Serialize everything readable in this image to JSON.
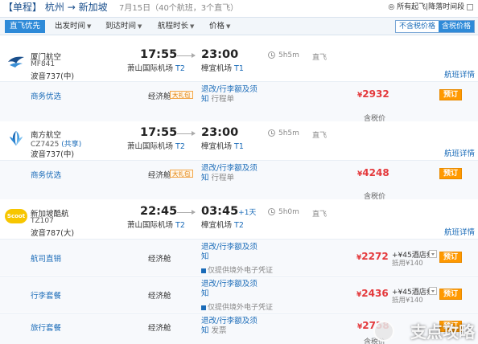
{
  "header": {
    "tag": "【单程】",
    "route_from": "杭州",
    "route_to": "新加坡",
    "summary": "7月15日（40个航班，3个直飞）",
    "opt_label": "所有起飞|降落时间段",
    "opt_prefix": "◎"
  },
  "toolbar": {
    "direct_first": "直飞优先",
    "sort_depart": "出发时间",
    "sort_arrive": "到达时间",
    "sort_duration": "航程时长",
    "sort_price": "价格",
    "price_excl_tax": "不含税价格",
    "price_incl_tax": "含税价格"
  },
  "flights": [
    {
      "airline": "厦门航空",
      "flight_no": "MF841",
      "aircraft": "波音737(中)",
      "dep_time": "17:55",
      "dep_airport": "萧山国际机场",
      "dep_terminal": "T2",
      "arr_time": "23:00",
      "arr_plus": "",
      "arr_airport": "樟宜机场",
      "arr_terminal": "T1",
      "duration": "5h5m",
      "stops": "直飞",
      "detail": "航班详情",
      "logo_color": "#1a4f8c",
      "fares": [
        {
          "label": "商务优选",
          "cabin": "经济舱",
          "badge": "大礼包",
          "rule_line1": "退改/行李额及须",
          "rule_line2": "知",
          "rule_line2_tail": "行程单",
          "price_symbol": "¥",
          "price": "2932",
          "tax": "含税价",
          "book": "预订"
        }
      ]
    },
    {
      "airline": "南方航空",
      "flight_no": "CZ7425",
      "codeshare": "(共享)",
      "aircraft": "波音737(中)",
      "dep_time": "17:55",
      "dep_airport": "萧山国际机场",
      "dep_terminal": "T2",
      "arr_time": "23:00",
      "arr_plus": "",
      "arr_airport": "樟宜机场",
      "arr_terminal": "T1",
      "duration": "5h5m",
      "stops": "直飞",
      "detail": "航班详情",
      "logo_color": "#1a6bb8",
      "fares": [
        {
          "label": "商务优选",
          "cabin": "经济舱",
          "badge": "大礼包",
          "rule_line1": "退改/行李额及须",
          "rule_line2": "知",
          "rule_line2_tail": "行程单",
          "price_symbol": "¥",
          "price": "4248",
          "tax": "含税价",
          "book": "预订"
        }
      ]
    },
    {
      "airline": "新加坡酷航",
      "flight_no": "TZ107",
      "aircraft": "波音787(大)",
      "dep_time": "22:45",
      "dep_airport": "萧山国际机场",
      "dep_terminal": "T2",
      "arr_time": "03:45",
      "arr_plus": "+1天",
      "arr_airport": "樟宜机场",
      "arr_terminal": "T2",
      "duration": "5h0m",
      "stops": "直飞",
      "detail": "航班详情",
      "logo_color": "#f7c600",
      "logo_text": "Scoot",
      "fares": [
        {
          "label": "航司直销",
          "cabin": "经济舱",
          "rule_line1": "退改/行李额及须",
          "rule_line2": "知",
          "rule_sub": "仅提供境外电子凭证",
          "price_symbol": "¥",
          "price": "2272",
          "coupon_main": "+¥45酒店券",
          "coupon_sub": "抵用¥140",
          "book": "预订"
        },
        {
          "label": "行李套餐",
          "cabin": "经济舱",
          "rule_line1": "退改/行李额及须",
          "rule_line2": "知",
          "rule_sub": "仅提供境外电子凭证",
          "price_symbol": "¥",
          "price": "2436",
          "coupon_main": "+¥45酒店券",
          "coupon_sub": "抵用¥140",
          "book": "预订"
        },
        {
          "label": "旅行套餐",
          "cabin": "经济舱",
          "rule_line1": "退改/行李额及须",
          "rule_line2": "知",
          "rule_sub": "发票",
          "price_symbol": "¥",
          "price": "2758",
          "tax": "含税价",
          "book": "预订"
        }
      ]
    }
  ],
  "watermark": "支点攻略"
}
